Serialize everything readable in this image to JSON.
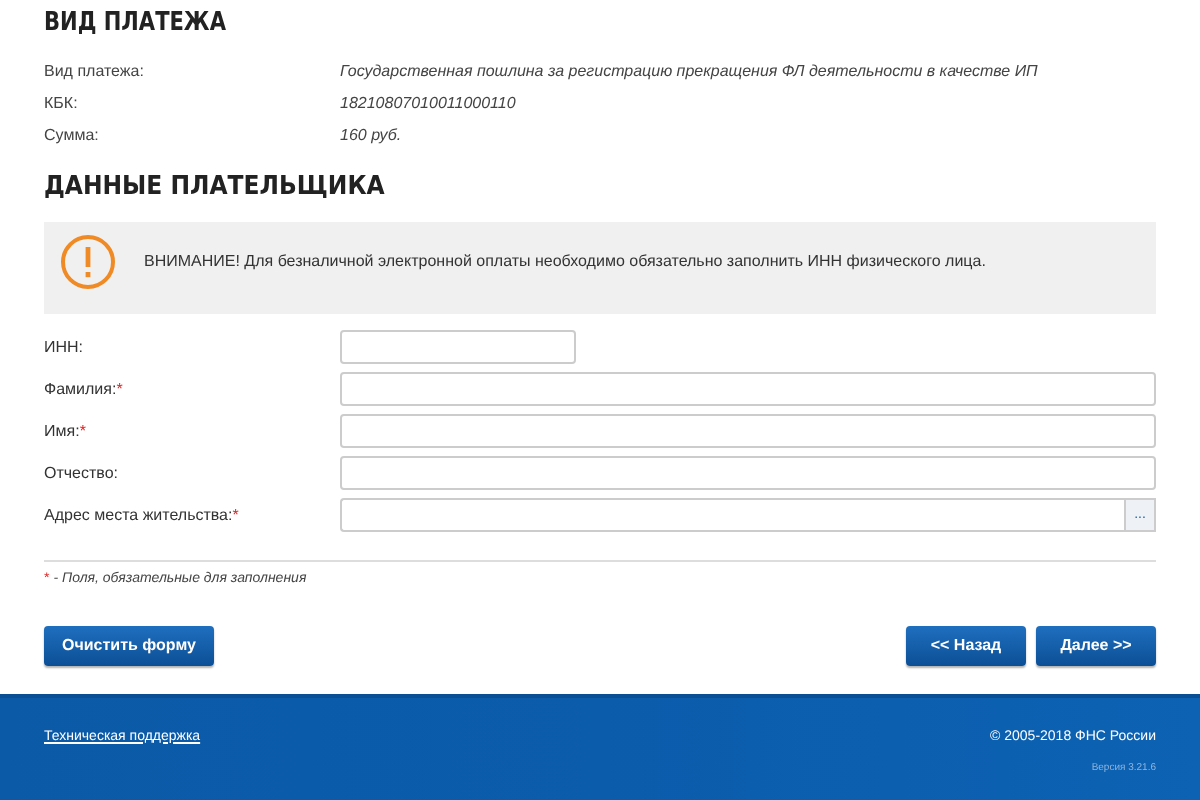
{
  "payment_section": {
    "title": "ВИД ПЛАТЕЖА",
    "rows": [
      {
        "label": "Вид платежа:",
        "value": "Государственная пошлина за регистрацию прекращения ФЛ деятельности в качестве ИП"
      },
      {
        "label": "КБК:",
        "value": "18210807010011000110"
      },
      {
        "label": "Сумма:",
        "value": "160 руб."
      }
    ]
  },
  "payer_section": {
    "title": "ДАННЫЕ ПЛАТЕЛЬЩИКА",
    "warning": "ВНИМАНИЕ! Для безналичной электронной оплаты необходимо обязательно заполнить ИНН физического лица.",
    "fields": [
      {
        "label": "ИНН:",
        "kind": "short"
      },
      {
        "label": "Фамилия:",
        "required_mark": "*",
        "kind": "text"
      },
      {
        "label": "Имя:",
        "required_mark": "*",
        "kind": "text"
      },
      {
        "label": "Отчество:",
        "kind": "text"
      },
      {
        "label": "Адрес места жительства:",
        "required_mark": "*",
        "kind": "lookup",
        "button": "..."
      }
    ],
    "required_note": {
      "mark": "*",
      "text": "- Поля, обязательные для заполнения"
    }
  },
  "buttons": {
    "clear": "Очистить форму",
    "back": "<< Назад",
    "next": "Далее >>"
  },
  "footer": {
    "support_link": "Техническая поддержка",
    "copyright": "© 2005-2018 ФНС России",
    "version": "Версия 3.21.6"
  }
}
